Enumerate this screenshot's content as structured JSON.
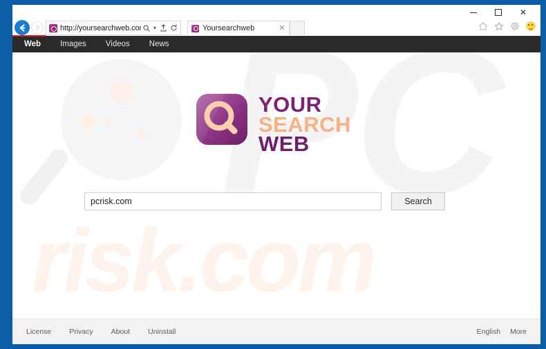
{
  "window": {
    "controls": {
      "minimize": "–",
      "maximize": "□",
      "close": "✕"
    }
  },
  "browser": {
    "back_icon": "back-arrow-icon",
    "forward_icon": "forward-arrow-icon",
    "address": {
      "url": "http://yoursearchweb.com/?ts=A",
      "favicon": "site-favicon",
      "search_icon": "🔍",
      "caret_icon": "▾",
      "compat_icon": "↑",
      "refresh_icon": "↻"
    },
    "tab": {
      "title": "Yoursearchweb",
      "close_label": "✕",
      "favicon": "tab-favicon"
    },
    "command_icons": {
      "home": "home-icon",
      "favorites": "star-icon",
      "settings": "gear-icon",
      "smiley": "smiley-icon"
    }
  },
  "sitenav": {
    "items": [
      {
        "label": "Web",
        "active": true
      },
      {
        "label": "Images",
        "active": false
      },
      {
        "label": "Videos",
        "active": false
      },
      {
        "label": "News",
        "active": false
      }
    ]
  },
  "brand": {
    "line1": "YOUR",
    "line2": "SEARCH",
    "line3": "WEB",
    "mark_icon": "magnifier-logo-icon",
    "colors": {
      "purple": "#7b2178",
      "peach": "#f7b184",
      "mark_dark": "#6e1f65",
      "mark_light": "#b06ba8"
    }
  },
  "search": {
    "value": "pcrisk.com",
    "placeholder": "",
    "button_label": "Search"
  },
  "watermark": {
    "letters": "PC",
    "text": "risk.com",
    "magnifier_icon": "watermark-magnifier-icon"
  },
  "footer": {
    "left_links": [
      "License",
      "Privacy",
      "About",
      "Uninstall"
    ],
    "right_links": [
      "English",
      "More"
    ]
  },
  "theme": {
    "frame_blue": "#0c5da8",
    "nav_dark": "#2a2a2a",
    "footer_bg": "#f2f2f2",
    "annotation_red": "#e01b1b"
  }
}
